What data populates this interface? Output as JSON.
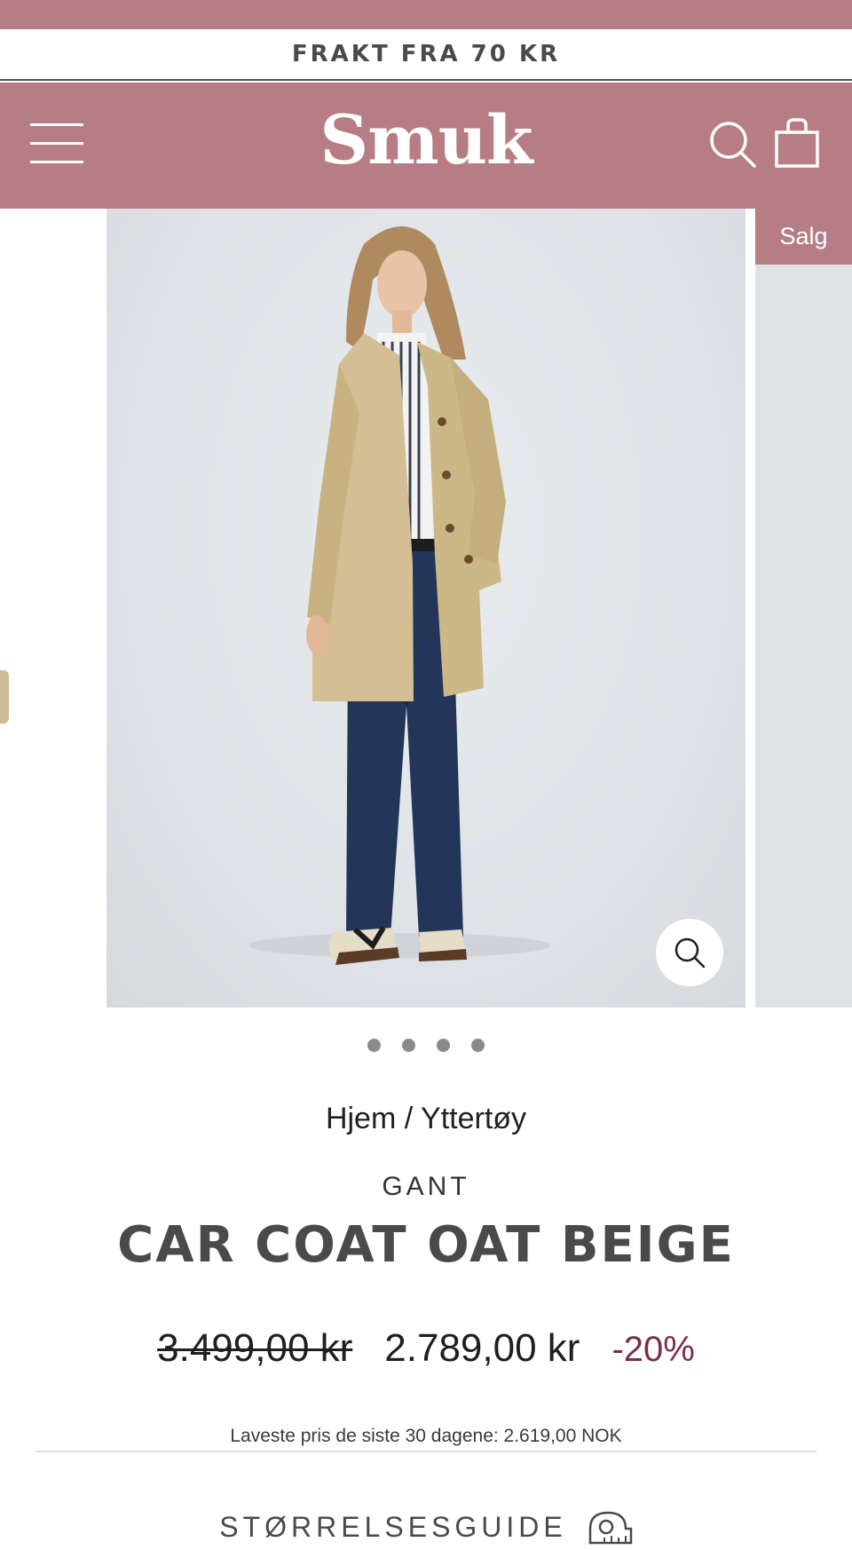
{
  "announcement": {
    "text": "FRAKT FRA 70 KR"
  },
  "header": {
    "logo": "Smuk",
    "icons": {
      "menu": "hamburger-menu-icon",
      "search": "search-icon",
      "cart": "shopping-bag-icon"
    },
    "background_color": "#b77d84"
  },
  "gallery": {
    "badge": "Salg",
    "dot_count": 4,
    "zoom_icon": "zoom-icon"
  },
  "product": {
    "breadcrumb": {
      "home": "Hjem",
      "separator": " / ",
      "category": "Yttertøy"
    },
    "brand": "GANT",
    "title": "CAR COAT OAT BEIGE",
    "price_original": "3.499,00 kr",
    "price_sale": "2.789,00 kr",
    "discount": "-20%",
    "lowest_price_note": "Laveste pris de siste 30 dagene: 2.619,00 NOK",
    "size_guide": "STØRRELSESGUIDE",
    "size_guide_icon": "measuring-tape-icon"
  },
  "colors": {
    "accent": "#b77d84",
    "discount": "#7a2e45"
  }
}
